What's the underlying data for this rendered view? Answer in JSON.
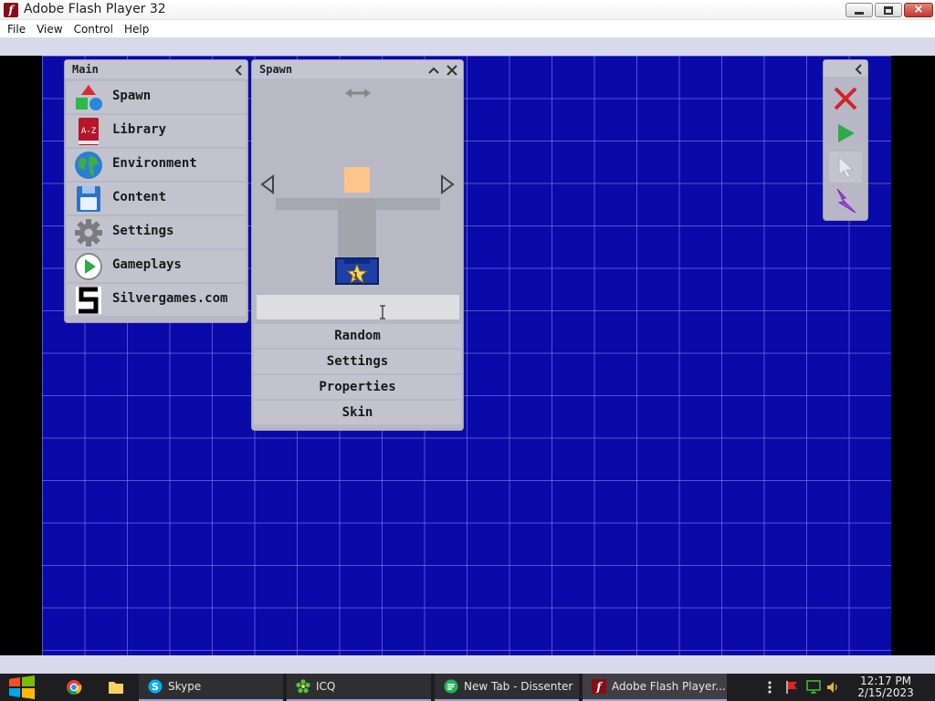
{
  "window": {
    "title": "Adobe Flash Player 32",
    "controls": {
      "minimize": "minimize",
      "maximize": "restore",
      "close": "×"
    }
  },
  "menu": [
    "File",
    "View",
    "Control",
    "Help"
  ],
  "main_panel": {
    "title": "Main",
    "collapse_glyph": "<",
    "items": [
      {
        "label": "Spawn",
        "icon": "shapes-icon"
      },
      {
        "label": "Library",
        "icon": "a-z-book-icon"
      },
      {
        "label": "Environment",
        "icon": "globe-icon"
      },
      {
        "label": "Content",
        "icon": "floppy-disk-icon"
      },
      {
        "label": "Settings",
        "icon": "gear-icon"
      },
      {
        "label": "Gameplays",
        "icon": "play-icon"
      },
      {
        "label": "Silvergames.com",
        "icon": "silvergames-logo-icon"
      }
    ]
  },
  "spawn_panel": {
    "title": "Spawn",
    "collapse_glyph": "^",
    "close_glyph": "×",
    "character_badge": "1",
    "input_value": "",
    "buttons": [
      "Random",
      "Settings",
      "Properties",
      "Skin"
    ]
  },
  "tool_panel": {
    "collapse_glyph": "<",
    "tools": [
      "delete-x-icon",
      "play-icon",
      "cursor-icon",
      "lightning-icon"
    ]
  },
  "taskbar": {
    "items": [
      {
        "label": "Skype"
      },
      {
        "label": "ICQ"
      },
      {
        "label": "New Tab - Dissenter"
      },
      {
        "label": "Adobe Flash Player..."
      }
    ],
    "time": "12:17 PM",
    "date": "2/15/2023"
  },
  "colors": {
    "stage_background": "#0a0aa8",
    "panel_background": "#b7b7c6",
    "taskbar_background": "#1e1e20"
  }
}
